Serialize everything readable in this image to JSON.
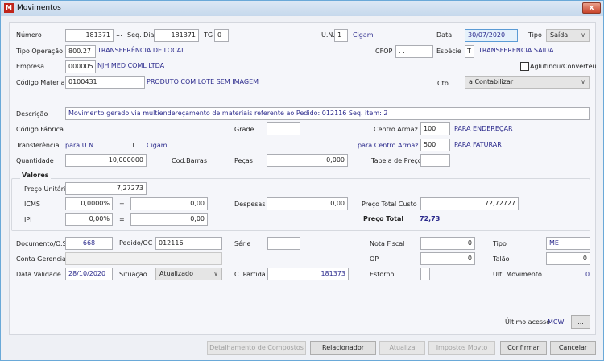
{
  "window": {
    "title": "Movimentos",
    "close_label": "x"
  },
  "header": {
    "numero_label": "Número",
    "numero": "181371",
    "numero_lookup": "...",
    "seq_dia_label": "Seq. Dia",
    "seq_dia": "181371",
    "tg_label": "TG",
    "tg": "0",
    "un_label": "U.N.",
    "un": "1",
    "un_name": "Cigam",
    "data_label": "Data",
    "data": "30/07/2020",
    "tipo_label": "Tipo",
    "tipo": "Saída",
    "tipo_operacao_label": "Tipo Operação",
    "tipo_operacao": "800.27",
    "tipo_operacao_desc": "TRANSFERÊNCIA DE LOCAL",
    "cfop_label": "CFOP",
    "cfop": ". .",
    "especie_label": "Espécie",
    "especie": "T",
    "especie_desc": "TRANSFERENCIA SAIDA",
    "empresa_label": "Empresa",
    "empresa": "000005",
    "empresa_desc": "NJH MED COML LTDA",
    "aglutinou_label": "Aglutinou/Converteu",
    "aglutinou_checked": false,
    "codigo_material_label": "Código Material",
    "codigo_material": "0100431",
    "codigo_material_desc": "PRODUTO COM LOTE SEM IMAGEM",
    "ctb_label": "Ctb.",
    "ctb": "a Contabilizar"
  },
  "detail": {
    "descricao_label": "Descrição",
    "descricao": "Movimento gerado via multiendereçamento de materiais referente ao Pedido: 012116 Seq. item: 2",
    "codigo_fabrica_label": "Código Fábrica",
    "grade_label": "Grade",
    "grade": "",
    "centro_armaz_label": "Centro Armaz.",
    "centro_armaz": "100",
    "centro_armaz_desc": "PARA ENDEREÇAR",
    "transferencia_label": "Transferência",
    "para_un_label": "para U.N.",
    "para_un": "1",
    "para_un_name": "Cigam",
    "para_centro_label": "para Centro Armaz.",
    "para_centro": "500",
    "para_centro_desc": "PARA FATURAR",
    "quantidade_label": "Quantidade",
    "quantidade": "10,000000",
    "cod_barras_label": "Cod.Barras",
    "pecas_label": "Peças",
    "pecas": "0,000",
    "tabela_preco_label": "Tabela de Preço",
    "tabela_preco": ""
  },
  "valores": {
    "title": "Valores",
    "preco_unitario_label": "Preço Unitário",
    "preco_unitario": "7,27273",
    "icms_label": "ICMS",
    "icms_pct": "0,0000%",
    "icms_value": "0,00",
    "eq": "=",
    "ipi_label": "IPI",
    "ipi_pct": "0,00%",
    "ipi_value": "0,00",
    "despesas_label": "Despesas",
    "despesas": "0,00",
    "preco_total_custo_label": "Preço Total Custo",
    "preco_total_custo": "72,72727",
    "preco_total_label": "Preço Total",
    "preco_total": "72,73"
  },
  "docs": {
    "documento_label": "Documento/O.S",
    "documento": "668",
    "pedido_label": "Pedido/OC",
    "pedido": "012116",
    "serie_label": "Série",
    "serie": "",
    "nota_fiscal_label": "Nota Fiscal",
    "nota_fiscal": "0",
    "tipo_label": "Tipo",
    "tipo": "ME",
    "conta_gerencial_label": "Conta Gerencial",
    "conta_gerencial": "",
    "op_label": "OP",
    "op": "0",
    "talao_label": "Talão",
    "talao": "0",
    "data_validade_label": "Data Validade",
    "data_validade": "28/10/2020",
    "situacao_label": "Situação",
    "situacao": "Atualizado",
    "c_partida_label": "C. Partida",
    "c_partida": "181373",
    "estorno_label": "Estorno",
    "estorno": "",
    "ult_movimento_label": "Ult. Movimento",
    "ult_movimento": "0",
    "ultimo_acesso_label": "Último acesso",
    "ultimo_acesso": "MCW",
    "ultimo_acesso_btn": "..."
  },
  "buttons": {
    "detalhamento": "Detalhamento de Compostos",
    "relacionador": "Relacionador",
    "atualiza": "Atualiza",
    "impostos": "Impostos Movto",
    "confirmar": "Confirmar",
    "cancelar": "Cancelar"
  },
  "colors": {
    "accent_text": "#2b2a8c",
    "close": "#c9442b"
  }
}
